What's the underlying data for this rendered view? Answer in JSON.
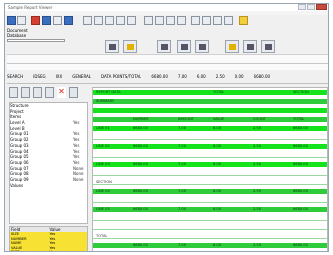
{
  "window": {
    "title": "Sample Report Viewer",
    "colors": {
      "accent": "#3a6fbf",
      "row_green": "#15e31c",
      "selection": "#3b67c8",
      "highlight": "#f7e234",
      "close": "#c74a3d"
    }
  },
  "left_info": {
    "label1": "Document",
    "label2": "Database"
  },
  "top_values": [
    "SEARCH",
    "IDSEG",
    "IXX",
    "GENERAL",
    "DATA POINTS/TOTAL",
    "6680.00",
    "7.00",
    "6.00",
    "2.50",
    "0.00",
    "6680.00"
  ],
  "tree": {
    "items": [
      {
        "label": "Structure",
        "value": ""
      },
      {
        "label": "  Project",
        "value": ""
      },
      {
        "label": "  Items",
        "value": ""
      },
      {
        "label": "  Level A",
        "value": "Yes"
      },
      {
        "label": "  Level B",
        "value": ""
      },
      {
        "label": "    Group 01",
        "value": "Yes"
      },
      {
        "label": "    Group 02",
        "value": "Yes"
      },
      {
        "label": "    Group 03",
        "value": "Yes"
      },
      {
        "label": "    Group 04",
        "value": "Yes"
      },
      {
        "label": "    Group 05",
        "value": "Yes"
      },
      {
        "label": "    Group 06",
        "value": "Yes"
      },
      {
        "label": "    Group 07",
        "value": "None"
      },
      {
        "label": "    Group 08",
        "value": "None"
      },
      {
        "label": "    Group 09",
        "value": "None"
      },
      {
        "label": "Values",
        "value": ""
      }
    ]
  },
  "props": {
    "headers": [
      "Field",
      "Value"
    ],
    "rows": [
      {
        "k": "SIZE",
        "v": "Yes"
      },
      {
        "k": "NUMBER",
        "v": "Yes"
      },
      {
        "k": "NAME",
        "v": "Yes"
      },
      {
        "k": "VALUE",
        "v": "Yes"
      },
      {
        "k": "TYPE",
        "v": "Yes"
      }
    ]
  },
  "report": {
    "rows": [
      {
        "cells": [
          "REPORT DATA",
          "",
          "",
          "TOTAL",
          "",
          "SECTION"
        ]
      },
      {
        "cells": [
          "SUMMARY",
          "",
          "",
          "",
          "",
          ""
        ]
      },
      {
        "cells": [
          "",
          "",
          "",
          "",
          "",
          ""
        ]
      },
      {
        "cells": [
          "",
          "NUMBER",
          "AMOUNT",
          "VALUE",
          "COUNT",
          "TOTAL"
        ]
      },
      {
        "cells": [
          "LINE 01",
          "6680.00",
          "7.00",
          "6.00",
          "2.50",
          "6680.00"
        ]
      },
      {
        "cells": [
          "",
          "",
          "",
          "",
          "",
          ""
        ]
      },
      {
        "cells": [
          "LINE 02",
          "6680.00",
          "7.00",
          "6.00",
          "2.50",
          "6680.00"
        ]
      },
      {
        "cells": [
          "",
          "",
          "",
          "",
          "",
          ""
        ]
      },
      {
        "cells": [
          "LINE 03",
          "6680.00",
          "7.00",
          "6.00",
          "2.50",
          "6680.00"
        ]
      },
      {
        "cells": [
          "",
          "",
          "",
          "",
          "",
          ""
        ]
      },
      {
        "cells": [
          "SECTION",
          "",
          "",
          "",
          "",
          ""
        ]
      },
      {
        "cells": [
          "LINE 04",
          "6680.00",
          "7.00",
          "6.00",
          "2.50",
          "6680.00"
        ]
      },
      {
        "cells": [
          "",
          "",
          "",
          "",
          "",
          ""
        ]
      },
      {
        "cells": [
          "LINE 05",
          "6680.00",
          "7.00",
          "6.00",
          "2.50",
          "6680.00"
        ]
      },
      {
        "cells": [
          "",
          "",
          "",
          "",
          "",
          ""
        ]
      },
      {
        "cells": [
          "",
          "",
          "",
          "",
          "",
          ""
        ]
      },
      {
        "cells": [
          "TOTAL",
          "",
          "",
          "",
          "",
          ""
        ]
      },
      {
        "cells": [
          "",
          "6680.00",
          "7.00",
          "6.00",
          "2.50",
          "6680.00"
        ]
      }
    ]
  }
}
